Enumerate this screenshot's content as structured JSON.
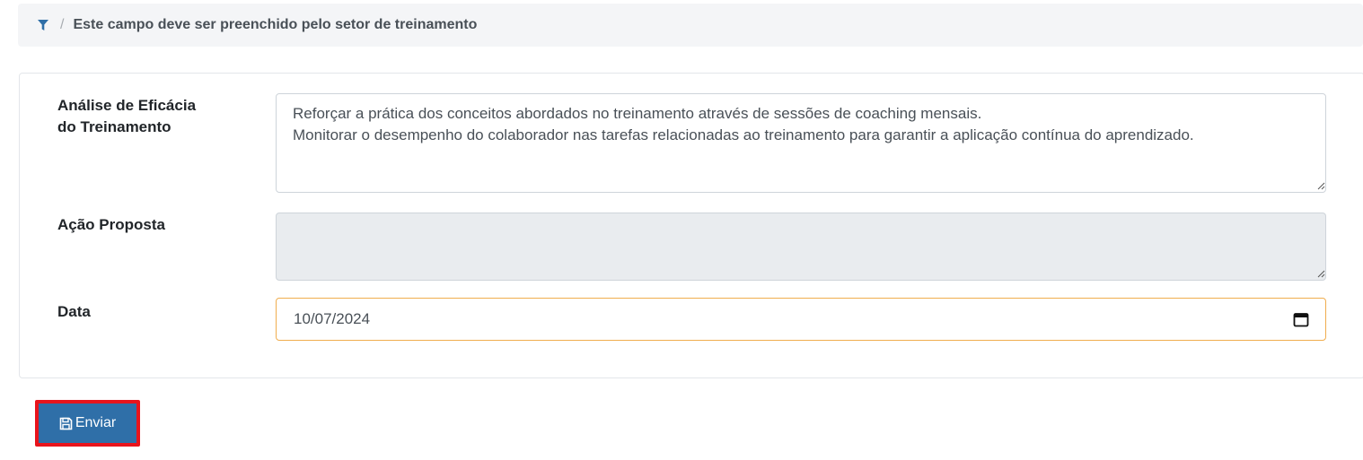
{
  "breadcrumb": {
    "icon": "filter-icon",
    "separator": "/",
    "text": "Este campo deve ser preenchido pelo setor de treinamento"
  },
  "form": {
    "eficacia": {
      "label_line1": "Análise de Eficácia",
      "label_line2": "do Treinamento",
      "value": "Reforçar a prática dos conceitos abordados no treinamento através de sessões de coaching mensais.\nMonitorar o desempenho do colaborador nas tarefas relacionadas ao treinamento para garantir a aplicação contínua do aprendizado."
    },
    "acao": {
      "label": "Ação Proposta",
      "value": ""
    },
    "data": {
      "label": "Data",
      "value": "10/07/2024",
      "icon": "calendar-icon"
    }
  },
  "submit": {
    "label": "Enviar",
    "icon": "save-icon"
  },
  "colors": {
    "primary_button": "#2f6fa8",
    "highlight_border": "#e8141c",
    "date_border": "#f0ad4e",
    "filter_icon": "#2f6fa8"
  }
}
